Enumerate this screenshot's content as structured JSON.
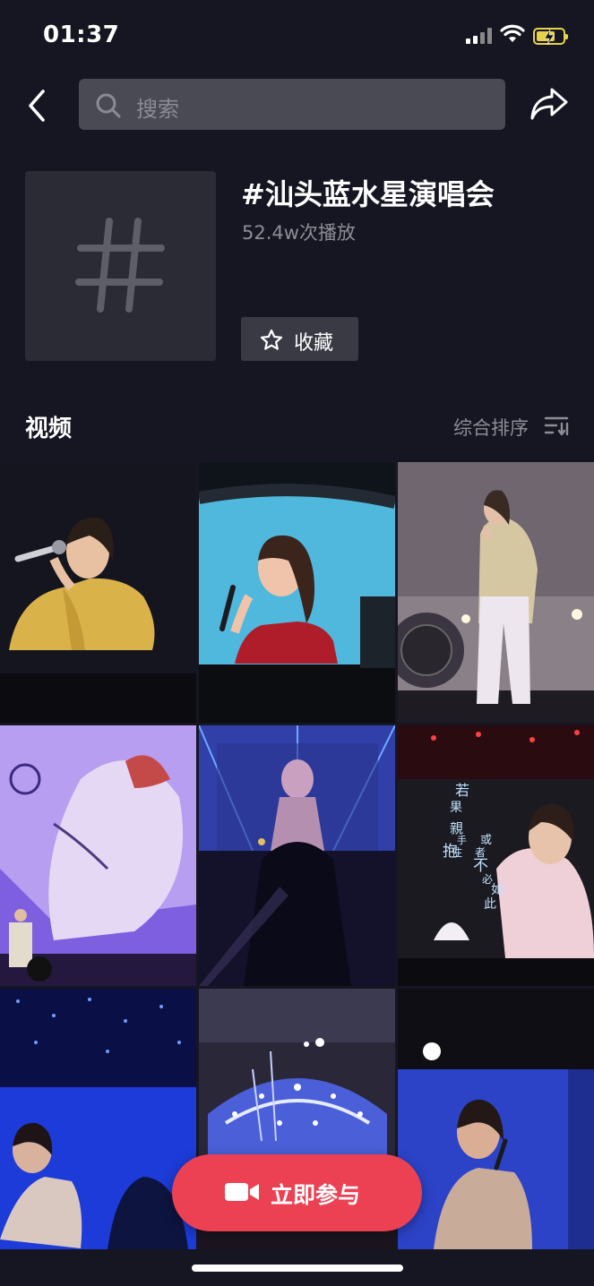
{
  "status_bar": {
    "time": "01:37",
    "battery_level": 0.55,
    "battery_color": "#e8d24a"
  },
  "nav": {
    "back_icon": "chevron-left-icon",
    "search_placeholder": "搜索",
    "share_icon": "share-icon"
  },
  "topic": {
    "cover_icon": "hashtag-icon",
    "title": "#汕头蓝水星演唱会",
    "plays": "52.4w次播放",
    "favorite_label": "收藏",
    "favorite_icon": "star-outline-icon"
  },
  "videos_section": {
    "title": "视频",
    "sort_label": "综合排序",
    "sort_icon": "sort-filter-icon"
  },
  "video_grid": {
    "items": [
      {
        "scene": "singer-yellow-jacket"
      },
      {
        "scene": "screen-singer-red-dress"
      },
      {
        "scene": "singer-on-stage-beige"
      },
      {
        "scene": "purple-screen-closeup"
      },
      {
        "scene": "blue-stage-crowd"
      },
      {
        "scene": "red-stage-lyrics",
        "overlay_lyrics": [
          "若",
          "果",
          "親",
          "手",
          "抱",
          "住",
          "或",
          "者",
          "不",
          "必",
          "如",
          "此"
        ]
      },
      {
        "scene": "blue-screen-singer"
      },
      {
        "scene": "arena-lights"
      },
      {
        "scene": "blue-screen-closeup"
      }
    ]
  },
  "join_button": {
    "label": "立即参与",
    "icon": "video-camera-icon",
    "color": "#ec4053"
  }
}
